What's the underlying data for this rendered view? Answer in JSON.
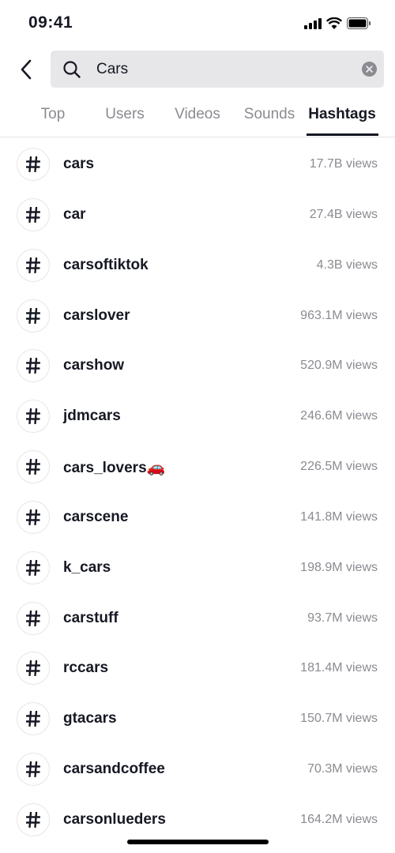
{
  "status_bar": {
    "time": "09:41",
    "icons": [
      "cellular-signal-icon",
      "wifi-icon",
      "battery-icon"
    ]
  },
  "search": {
    "value": "Cars",
    "icon": "search-icon",
    "clear_icon": "clear-icon",
    "back_icon": "chevron-left-icon"
  },
  "tabs": [
    {
      "label": "Top",
      "active": false
    },
    {
      "label": "Users",
      "active": false
    },
    {
      "label": "Videos",
      "active": false
    },
    {
      "label": "Sounds",
      "active": false
    },
    {
      "label": "Hashtags",
      "active": true
    }
  ],
  "hashtags": [
    {
      "name": "cars",
      "views": "17.7B views"
    },
    {
      "name": "car",
      "views": "27.4B views"
    },
    {
      "name": "carsoftiktok",
      "views": "4.3B views"
    },
    {
      "name": "carslover",
      "views": "963.1M views"
    },
    {
      "name": "carshow",
      "views": "520.9M views"
    },
    {
      "name": "jdmcars",
      "views": "246.6M views"
    },
    {
      "name": "cars_lovers🚗",
      "views": "226.5M views"
    },
    {
      "name": "carscene",
      "views": "141.8M views"
    },
    {
      "name": "k_cars",
      "views": "198.9M views"
    },
    {
      "name": "carstuff",
      "views": "93.7M views"
    },
    {
      "name": "rccars",
      "views": "181.4M views"
    },
    {
      "name": "gtacars",
      "views": "150.7M views"
    },
    {
      "name": "carsandcoffee",
      "views": "70.3M views"
    },
    {
      "name": "carsonlueders",
      "views": "164.2M views"
    }
  ],
  "colors": {
    "text": "#161823",
    "secondary": "#8a8b91",
    "search_bg": "#e7e7e9"
  }
}
